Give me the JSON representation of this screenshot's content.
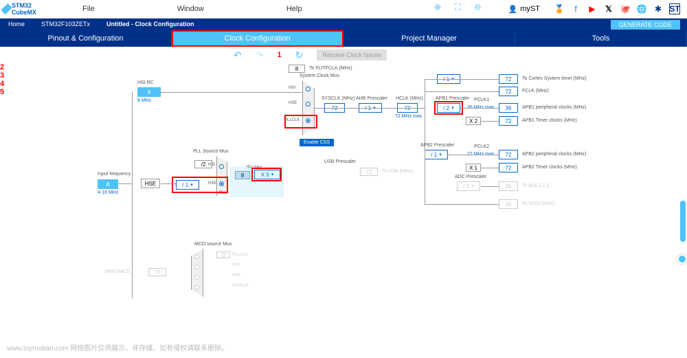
{
  "app": {
    "name": "STM32 CubeMX"
  },
  "menu": {
    "file": "File",
    "window": "Window",
    "help": "Help",
    "myst": "myST"
  },
  "breadcrumb": {
    "home": "Home",
    "chip": "STM32F103ZETx",
    "page": "Untitled - Clock Configuration"
  },
  "generate": "GENERATE CODE",
  "tabs": {
    "pinout": "Pinout & Configuration",
    "clock": "Clock Configuration",
    "project": "Project Manager",
    "tools": "Tools"
  },
  "toolbar": {
    "resolve": "Resolve Clock Issues"
  },
  "annotations": {
    "a1": "1",
    "a2": "2",
    "a3": "3",
    "a4": "4",
    "a5": "5"
  },
  "clk": {
    "hsi_rc": "HSI RC",
    "hsi_val": "8",
    "hsi_unit": "8 MHz",
    "input_freq": "Input frequency",
    "input_val": "8",
    "input_unit": "4-16 MHz",
    "hse": "HSE",
    "pll_src": "PLL Source Mux",
    "pll_div2": "/2",
    "pll_div1": "/ 1",
    "pll_hsi": "HSI",
    "pll_hse": "HSE",
    "pll": "PLL",
    "pll_mul": "*PLLMul",
    "pll_mul_in": "8",
    "pll_mul_val": "X 9",
    "sys_mux": "System Clock Mux",
    "sm_hsi": "HSI",
    "sm_hse": "HSE",
    "sm_pllclk": "PLLCLK",
    "enable_css": "Enable CSS",
    "flitf": "8",
    "flitf_label": "To FLITFCLK (MHz)",
    "sysclk": "SYSCLK (MHz)",
    "sysclk_val": "72",
    "ahb": "AHB Prescaler",
    "ahb_val": "/ 1",
    "hclk": "HCLK (MHz)",
    "hclk_val": "72",
    "hclk_note": "72 MHz max",
    "usb": "USB Prescaler",
    "usb_val": "72",
    "usb_label": "To USB (MHz)",
    "cortex_div": "/ 1",
    "cortex_val": "72",
    "cortex_label": "To Cortex System timer (MHz)",
    "fclk_val": "72",
    "fclk_label": "FCLK (MHz)",
    "apb1": "APB1 Prescaler",
    "apb1_val": "/ 2",
    "apb1_note": "36 MHz max",
    "pclk1": "PCLK1",
    "pclk1_val": "36",
    "pclk1_label": "APB1 peripheral clocks (MHz)",
    "apb1t": "X 2",
    "apb1t_val": "72",
    "apb1t_label": "APB1 Timer clocks (MHz)",
    "apb2": "APB2 Prescaler",
    "apb2_val": "/ 1",
    "apb2_note": "72 MHz max",
    "pclk2": "PCLK2",
    "pclk2_val": "72",
    "pclk2_label": "APB2 peripheral clocks (MHz)",
    "apb2t": "X 1",
    "apb2t_val": "72",
    "apb2t_label": "APB2 Timer clocks (MHz)",
    "adc": "ADC Prescaler",
    "adc_div": "/ 2",
    "adc_val": "36",
    "adc_label": "To ADC1,2,3",
    "sdio_val": "36",
    "sdio_label": "To SDIO (MHz)",
    "mco_src": "MCO source Mux",
    "mco_d2": "/2",
    "mco_pllclk": "PLLCLK",
    "mco_hsi": "HSI",
    "mco_hse": "HSE",
    "mco_sysclk": "SYSCLK",
    "mco_out": "72",
    "mco_label": "(MHz) MCO"
  },
  "watermark": "www.toymoban.com  网络图片仅供展示，非存储，如有侵权请联系删除。"
}
